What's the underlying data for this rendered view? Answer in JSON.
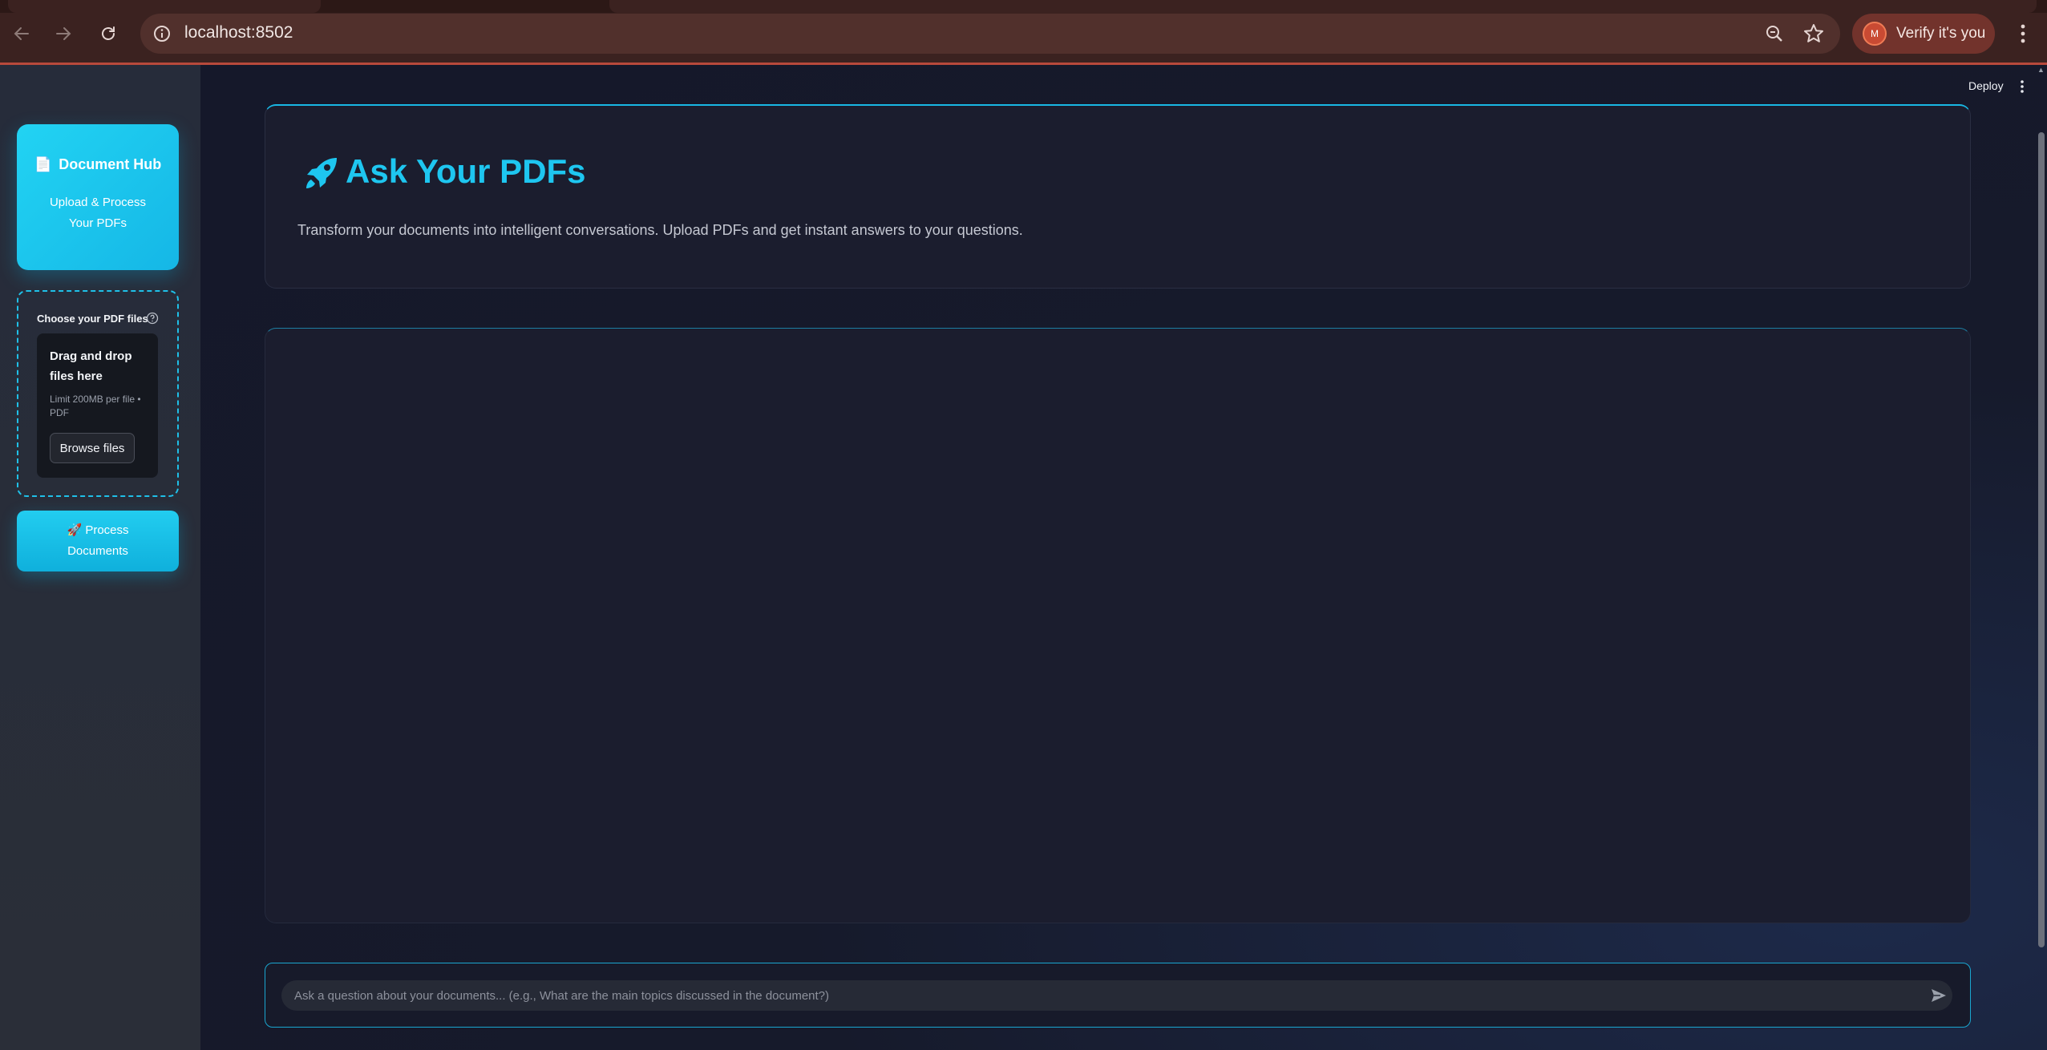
{
  "browser": {
    "url": "localhost:8502",
    "verify_label": "Verify it's you",
    "avatar_initial": "M",
    "icons": [
      "back-icon",
      "forward-icon",
      "reload-icon",
      "site-info-icon",
      "zoom-icon",
      "bookmark-star-icon",
      "more-vert-icon"
    ]
  },
  "sidebar": {
    "hub_title": "Document Hub",
    "hub_icon": "📄",
    "hub_subtitle": "Upload & Process Your PDFs",
    "upload_label": "Choose your PDF files",
    "drop_title": "Drag and drop files here",
    "drop_limit": "Limit 200MB per file • PDF",
    "browse_label": "Browse files",
    "process_label": "🚀 Process Documents"
  },
  "toolbar": {
    "deploy_label": "Deploy"
  },
  "main": {
    "title": "Ask Your PDFs",
    "description": "Transform your documents into intelligent conversations. Upload PDFs and get instant answers to your questions."
  },
  "chat": {
    "placeholder": "Ask a question about your documents... (e.g., What are the main topics discussed in the document?)",
    "value": ""
  },
  "colors": {
    "accent": "#1ec6f0",
    "sidebar_bg": "#262c3a",
    "main_bg": "#161a2b",
    "chrome_bg": "#3b2220"
  }
}
